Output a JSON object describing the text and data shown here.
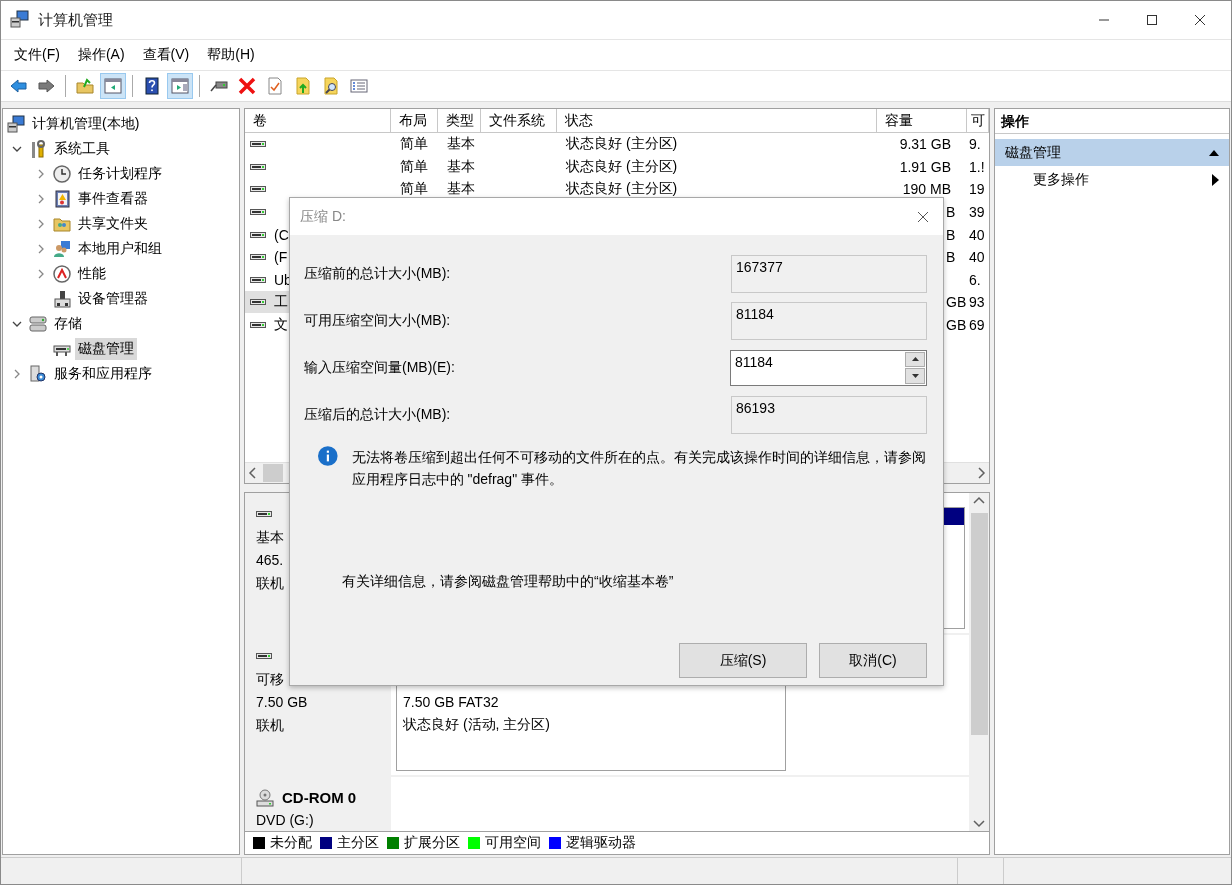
{
  "window": {
    "title": "计算机管理"
  },
  "menu": [
    "文件(F)",
    "操作(A)",
    "查看(V)",
    "帮助(H)"
  ],
  "toolbar": [
    {
      "pressed": false
    },
    {
      "pressed": false
    },
    {
      "pressed": false
    },
    {
      "pressed": true
    },
    {
      "pressed": false
    },
    {
      "pressed": true
    },
    {
      "pressed": false
    },
    {
      "pressed": false
    },
    {
      "pressed": false
    },
    {
      "pressed": false
    },
    {
      "pressed": false
    },
    {
      "pressed": false
    }
  ],
  "tree": [
    {
      "label": "计算机管理(本地)",
      "selected": false,
      "children": [
        {
          "label": "系统工具",
          "expanded": true,
          "selected": false,
          "children": [
            {
              "label": "任务计划程序",
              "expanded": false,
              "selected": false
            },
            {
              "label": "事件查看器",
              "expanded": false,
              "selected": false
            },
            {
              "label": "共享文件夹",
              "expanded": false,
              "selected": false
            },
            {
              "label": "本地用户和组",
              "expanded": false,
              "selected": false
            },
            {
              "label": "性能",
              "expanded": false,
              "selected": false
            },
            {
              "label": "设备管理器",
              "selected": false
            }
          ]
        },
        {
          "label": "存储",
          "expanded": true,
          "selected": false,
          "children": [
            {
              "label": "磁盘管理",
              "selected": true
            }
          ]
        },
        {
          "label": "服务和应用程序",
          "expanded": false,
          "selected": false
        }
      ]
    }
  ],
  "table": {
    "columns": [
      "卷",
      "布局",
      "类型",
      "文件系统",
      "状态",
      "容量",
      "可"
    ],
    "rows": [
      {
        "selected": false,
        "layout": "简单",
        "type": "基本",
        "status": "状态良好 (主分区)",
        "capacity": "9.31 GB",
        "column_7": "9."
      },
      {
        "selected": false,
        "layout": "简单",
        "type": "基本",
        "status": "状态良好 (主分区)",
        "capacity": "1.91 GB",
        "column_7": "1.!"
      },
      {
        "selected": false,
        "layout": "简单",
        "type": "基本",
        "status": "状态良好 (主分区)",
        "capacity": "190 MB",
        "column_7": "19"
      },
      {
        "selected": false,
        "capacity": "B",
        "column_7": "39"
      },
      {
        "selected": false,
        "volume": "(C",
        "capacity": "B",
        "column_7": "40"
      },
      {
        "selected": false,
        "volume": "(F",
        "capacity": "B",
        "column_7": "40"
      },
      {
        "selected": false,
        "volume": "Ub",
        "column_7": "6."
      },
      {
        "selected": true,
        "volume": "工",
        "capacity": "GB",
        "column_7": "93"
      },
      {
        "selected": false,
        "volume": "文",
        "capacity": "GB",
        "column_7": "69"
      }
    ]
  },
  "disks": [
    {
      "kind": "disk",
      "lines": [
        "基本",
        "465.",
        "联机"
      ],
      "partition": {
        "kind": "primary"
      }
    },
    {
      "kind": "disk",
      "lines": [
        "可移",
        "7.50 GB",
        "联机"
      ],
      "partition": {
        "kind": "primary",
        "lines": [
          "7.50 GB FAT32",
          "状态良好 (活动, 主分区)"
        ]
      }
    },
    {
      "kind": "cdrom",
      "name": "CD-ROM 0",
      "lines": [
        "DVD (G:)"
      ]
    }
  ],
  "legend": [
    {
      "label": "未分配",
      "color": "#000000"
    },
    {
      "label": "主分区",
      "color": "#000080"
    },
    {
      "label": "扩展分区",
      "color": "#008000"
    },
    {
      "label": "可用空间",
      "color": "#00ff00"
    },
    {
      "label": "逻辑驱动器",
      "color": "#0000ff"
    }
  ],
  "actions": {
    "title": "操作",
    "section": {
      "label": "磁盘管理",
      "expanded": true
    },
    "items": [
      "更多操作"
    ]
  },
  "dialog": {
    "title": "压缩 D:",
    "fields": [
      {
        "kind": "readonly",
        "label": "压缩前的总计大小(MB):",
        "value": "167377"
      },
      {
        "kind": "readonly",
        "label": "可用压缩空间大小(MB):",
        "value": "81184"
      },
      {
        "kind": "spin",
        "label": "输入压缩空间量(MB)(E):",
        "value": "81184"
      },
      {
        "kind": "readonly",
        "label": "压缩后的总计大小(MB):",
        "value": "86193"
      }
    ],
    "info": "无法将卷压缩到超出任何不可移动的文件所在的点。有关完成该操作时间的详细信息，请参阅应用程序日志中的 \"defrag\" 事件。",
    "help": "有关详细信息，请参阅磁盘管理帮助中的“收缩基本卷”",
    "buttons": [
      "压缩(S)",
      "取消(C)"
    ]
  }
}
